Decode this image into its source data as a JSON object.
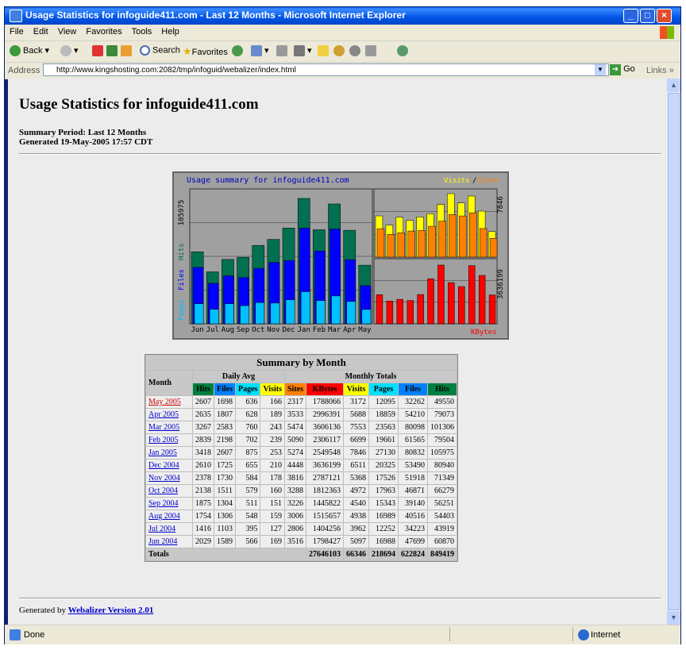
{
  "window": {
    "title": "Usage Statistics for infoguide411.com - Last 12 Months - Microsoft Internet Explorer"
  },
  "menu": [
    "File",
    "Edit",
    "View",
    "Favorites",
    "Tools",
    "Help"
  ],
  "toolbar": {
    "back": "Back",
    "search": "Search",
    "favorites": "Favorites"
  },
  "address": {
    "label": "Address",
    "url": "http://www.kingshosting.com:2082/tmp/infoguid/webalizer/index.html",
    "go": "Go",
    "links": "Links"
  },
  "page": {
    "title": "Usage Statistics for infoguide411.com",
    "period": "Summary Period: Last 12 Months",
    "generated": "Generated 19-May-2005 17:57 CDT"
  },
  "chart_data": {
    "type": "bar",
    "title": "Usage summary for infoguide411.com",
    "categories": [
      "Jun",
      "Jul",
      "Aug",
      "Sep",
      "Oct",
      "Nov",
      "Dec",
      "Jan",
      "Feb",
      "Mar",
      "Apr",
      "May"
    ],
    "left_axis_max_label": "105975",
    "left_legend": [
      "Pages",
      "Files",
      "Hits"
    ],
    "series": [
      {
        "name": "Hits",
        "color": "#007050",
        "values": [
          60870,
          43919,
          54403,
          56251,
          66279,
          71349,
          80940,
          105975,
          79504,
          101306,
          79073,
          49550
        ]
      },
      {
        "name": "Files",
        "color": "#0000ff",
        "values": [
          47699,
          34223,
          40516,
          39140,
          46871,
          51918,
          53490,
          80832,
          61565,
          80098,
          54210,
          32262
        ]
      },
      {
        "name": "Pages",
        "color": "#00c0ff",
        "values": [
          16988,
          12252,
          16989,
          15343,
          17963,
          17526,
          20325,
          27130,
          19661,
          23563,
          18859,
          12095
        ]
      }
    ],
    "right_top": {
      "legend": [
        "Visits",
        "Sites"
      ],
      "max_label": "7846",
      "visits": {
        "color": "#ffff00",
        "values": [
          5097,
          3962,
          4938,
          4540,
          4972,
          5368,
          6511,
          7846,
          6699,
          7553,
          5688,
          3172
        ]
      },
      "sites": {
        "color": "#ff8000",
        "values": [
          3516,
          2806,
          3006,
          3226,
          3288,
          3816,
          4448,
          5274,
          5090,
          5474,
          3533,
          2317
        ]
      }
    },
    "right_bottom": {
      "legend": "KBytes",
      "max_label": "3636199",
      "color": "#ff0000",
      "values": [
        1798427,
        1404256,
        1515657,
        1445822,
        1812363,
        2787121,
        3636199,
        2549548,
        2306117,
        3606136,
        2996391,
        1788066
      ]
    }
  },
  "table": {
    "caption": "Summary by Month",
    "month_header": "Month",
    "daily_header": "Daily Avg",
    "monthly_header": "Monthly Totals",
    "daily_cols": [
      {
        "label": "Hits",
        "color": "#008040"
      },
      {
        "label": "Files",
        "color": "#0080ff"
      },
      {
        "label": "Pages",
        "color": "#00e0ff"
      },
      {
        "label": "Visits",
        "color": "#ffff00"
      }
    ],
    "monthly_cols": [
      {
        "label": "Sites",
        "color": "#ff8000"
      },
      {
        "label": "KBytes",
        "color": "#ff0000"
      },
      {
        "label": "Visits",
        "color": "#ffff00"
      },
      {
        "label": "Pages",
        "color": "#00e0ff"
      },
      {
        "label": "Files",
        "color": "#0080ff"
      },
      {
        "label": "Hits",
        "color": "#008040"
      }
    ],
    "rows": [
      {
        "month": "May 2005",
        "current": true,
        "d": [
          2607,
          1698,
          636,
          166
        ],
        "m": [
          2317,
          1788066,
          3172,
          12095,
          32262,
          49550
        ]
      },
      {
        "month": "Apr 2005",
        "d": [
          2635,
          1807,
          628,
          189
        ],
        "m": [
          3533,
          2996391,
          5688,
          18859,
          54210,
          79073
        ]
      },
      {
        "month": "Mar 2005",
        "d": [
          3267,
          2583,
          760,
          243
        ],
        "m": [
          5474,
          3606136,
          7553,
          23563,
          80098,
          101306
        ]
      },
      {
        "month": "Feb 2005",
        "d": [
          2839,
          2198,
          702,
          239
        ],
        "m": [
          5090,
          2306117,
          6699,
          19661,
          61565,
          79504
        ]
      },
      {
        "month": "Jan 2005",
        "d": [
          3418,
          2607,
          875,
          253
        ],
        "m": [
          5274,
          2549548,
          7846,
          27130,
          80832,
          105975
        ]
      },
      {
        "month": "Dec 2004",
        "d": [
          2610,
          1725,
          655,
          210
        ],
        "m": [
          4448,
          3636199,
          6511,
          20325,
          53490,
          80940
        ]
      },
      {
        "month": "Nov 2004",
        "d": [
          2378,
          1730,
          584,
          178
        ],
        "m": [
          3816,
          2787121,
          5368,
          17526,
          51918,
          71349
        ]
      },
      {
        "month": "Oct 2004",
        "d": [
          2138,
          1511,
          579,
          160
        ],
        "m": [
          3288,
          1812363,
          4972,
          17963,
          46871,
          66279
        ]
      },
      {
        "month": "Sep 2004",
        "d": [
          1875,
          1304,
          511,
          151
        ],
        "m": [
          3226,
          1445822,
          4540,
          15343,
          39140,
          56251
        ]
      },
      {
        "month": "Aug 2004",
        "d": [
          1754,
          1306,
          548,
          159
        ],
        "m": [
          3006,
          1515657,
          4938,
          16989,
          40516,
          54403
        ]
      },
      {
        "month": "Jul 2004",
        "d": [
          1416,
          1103,
          395,
          127
        ],
        "m": [
          2806,
          1404256,
          3962,
          12252,
          34223,
          43919
        ]
      },
      {
        "month": "Jun 2004",
        "d": [
          2029,
          1589,
          566,
          169
        ],
        "m": [
          3516,
          1798427,
          5097,
          16988,
          47699,
          60870
        ]
      }
    ],
    "totals_label": "Totals",
    "totals": [
      "27646103",
      "66346",
      "218694",
      "622824",
      "849419"
    ]
  },
  "footer": {
    "prefix": "Generated by",
    "link": "Webalizer Version 2.01"
  },
  "status": {
    "left": "Done",
    "zone": "Internet"
  }
}
